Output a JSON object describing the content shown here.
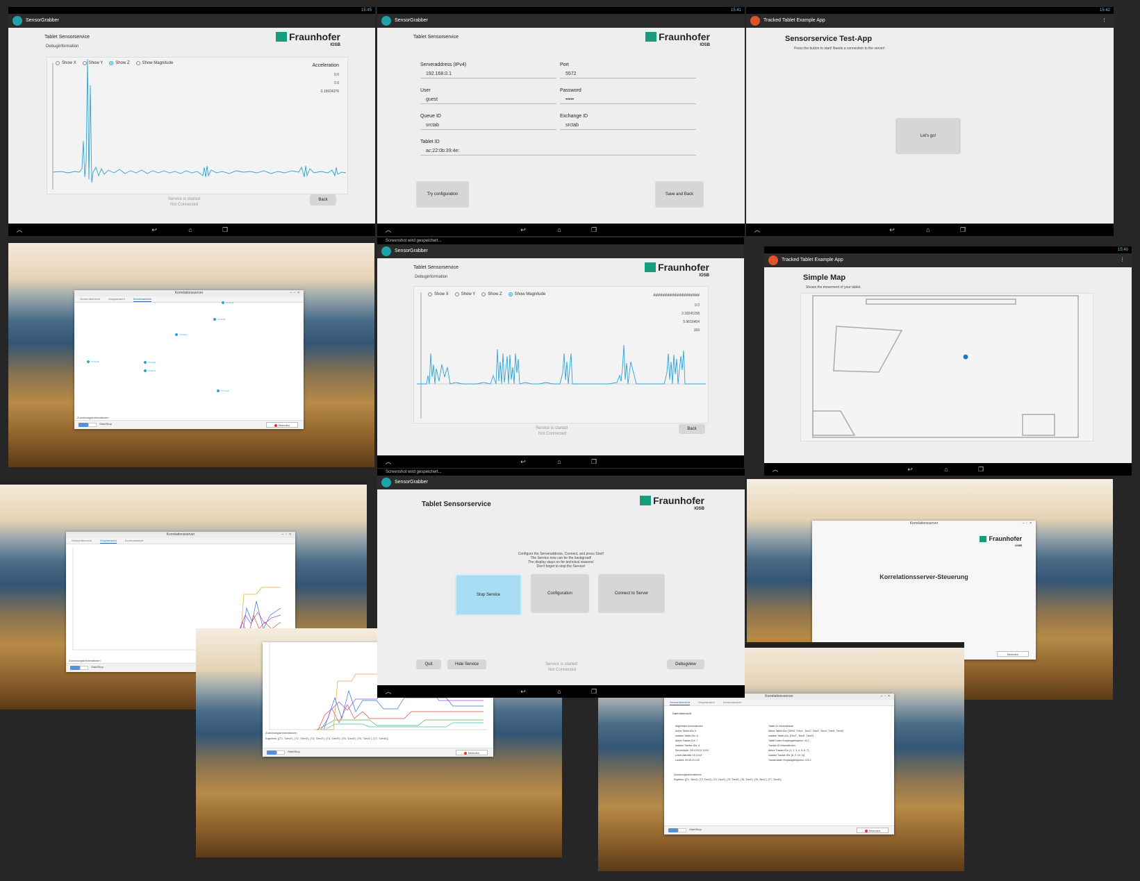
{
  "panel_debug_z": {
    "status_time": "15:45",
    "app_name": "SensorGrabber",
    "title": "Tablet Sensorservice",
    "subtitle": "Debuginformation",
    "logo_name": "Fraunhofer",
    "logo_sub": "IOSB",
    "radios": [
      {
        "label": "Show X",
        "selected": false
      },
      {
        "label": "Show Y",
        "selected": false
      },
      {
        "label": "Show Z",
        "selected": true
      },
      {
        "label": "Show Magnitude",
        "selected": false
      }
    ],
    "readout_title": "Acceleration",
    "readout_values": [
      "0.0",
      "0.0",
      "0.19924376"
    ],
    "status_line1": "Service is started",
    "status_line2": "Not Connected",
    "back_label": "Back"
  },
  "panel_config": {
    "status_time": "15:41",
    "app_name": "SensorGrabber",
    "title": "Tablet Sensorservice",
    "logo_name": "Fraunhofer",
    "logo_sub": "IOSB",
    "fields": {
      "server_label": "Serveraddress (IPv4)",
      "server_value": "192.168.0.1",
      "port_label": "Port",
      "port_value": "5572",
      "user_label": "User",
      "user_value": "guest",
      "password_label": "Password",
      "password_value": "•••••",
      "queue_label": "Queue ID",
      "queue_value": "srctab",
      "exchange_label": "Exchange ID",
      "exchange_value": "srctab",
      "tablet_label": "Tablet ID",
      "tablet_value": "ac:22:0b:39:4e:"
    },
    "try_label": "Try configuration",
    "save_label": "Save and Back"
  },
  "panel_testapp": {
    "status_time": "15:42",
    "app_name": "Tracked Tablet Example App",
    "title": "Sensorservice Test-App",
    "subtitle": "Press the button to start! Needs a connection to the server!",
    "go_label": "Let's go!"
  },
  "panel_desktop1": {
    "window_title": "Korrelationsserver",
    "tabs": [
      "Sensorübersicht",
      "Graphansicht",
      "Kameraansicht"
    ],
    "active_tab": 2,
    "point_labels": [
      "T1 Dev4",
      "T2 Dev3",
      "T3 Dev2",
      "T4 Dev5",
      "T5 Dev0",
      "T6 Dev1",
      "T7 Dev6"
    ],
    "footer_label": "Zuordnungsinformationen",
    "start_stop": "Start/Stop",
    "end_label": "Beenden"
  },
  "panel_debug_mag": {
    "status_bar_text": "Screenshot wird gespeichert...",
    "app_name": "SensorGrabber",
    "title": "Tablet Sensorservice",
    "subtitle": "Debuginformation",
    "logo_name": "Fraunhofer",
    "logo_sub": "IOSB",
    "radios": [
      {
        "label": "Show X",
        "selected": false
      },
      {
        "label": "Show Y",
        "selected": false
      },
      {
        "label": "Show Z",
        "selected": false
      },
      {
        "label": "Show Magnitude",
        "selected": true
      }
    ],
    "readout_title": "####################",
    "readout_values": [
      "0.0",
      "3.18241158",
      "5.9616404",
      "169"
    ],
    "status_line1": "Service is started",
    "status_line2": "Not Connected",
    "back_label": "Back"
  },
  "panel_map": {
    "status_time": "15:40",
    "app_name": "Tracked Tablet Example App",
    "title": "Simple Map",
    "subtitle": "Shows the movement of your tablet."
  },
  "panel_desktop2": {
    "window_title": "Korrelationsserver",
    "tabs": [
      "Sensorübersicht",
      "Graphansicht",
      "Kameraansicht"
    ],
    "active_tab": 1,
    "footer_label": "Zuordnungsinformationen",
    "start_stop": "Start/Stop",
    "end_label": "Beenden"
  },
  "panel_main": {
    "status_bar_text": "Screenshot wird gespeichert...",
    "app_name": "SensorGrabber",
    "title": "Tablet Sensorservice",
    "logo_name": "Fraunhofer",
    "logo_sub": "IOSB",
    "instructions": [
      "Configure the Serveraddress, Connect, and press Start!",
      "The Service now can be the backgroud!",
      "The display stays on for technical reasons!",
      "Don't forget to stop the Service!"
    ],
    "stop_label": "Stop Service",
    "config_label": "Configuration",
    "connect_label": "Connect to Server",
    "quit_label": "Quit",
    "hide_label": "Hide Service",
    "status_line1": "Service is started",
    "status_line2": "Not Connected",
    "debug_label": "Debugview"
  },
  "panel_desktop3": {
    "window_title": "Korrelationsserver",
    "logo_name": "Fraunhofer",
    "logo_sub": "IOSB",
    "heading": "Korrelationsserver-Steuerung",
    "end_label": "Beenden"
  },
  "panel_desktop4": {
    "footer_label": "Zuordnungsinformationen",
    "ergebnis_text": "Ergebnis: [(T1, 'Dev4'), (T2, 'Dev3'), (T3, 'Dev2'), (T4, 'Dev5'), (T5, 'Dev0'), (T6, 'Dev1'), (T7, 'Dev6')]",
    "start_stop": "Start/Stop",
    "end_label": "Beenden"
  },
  "panel_desktop5": {
    "window_title": "Korrelationsserver",
    "tabs": [
      "Sensorübersicht",
      "Graphansicht",
      "Kameraansicht"
    ],
    "active_tab": 0,
    "section_title": "Datenübersicht",
    "left_heading": "Allgemeine Informationen",
    "left_rows": [
      {
        "k": "Aktive Tablet-IDs:",
        "v": "6"
      },
      {
        "k": "Inaktive Tablet-IDs:",
        "v": "6"
      },
      {
        "k": "Aktive Tracker-IDs:",
        "v": "7"
      },
      {
        "k": "Inaktive Tracker-IDs:",
        "v": "4"
      },
      {
        "k": "Serverstarte:",
        "v": "2014.03.21 13:02"
      },
      {
        "k": "Letzte Aktivität:",
        "v": "13:13:42"
      },
      {
        "k": "Laufzeit:",
        "v": "00:00:23.125"
      }
    ],
    "right_heading": "Tablet-ID Informationen",
    "right_rows": [
      {
        "k": "Aktive Tablet-IDs:",
        "v": "['Dev0', 'Dev1', 'Dev2', 'Dev3', 'Dev4', 'Dev5', 'Dev6']"
      },
      {
        "k": "Inaktive Tablet-IDs:",
        "v": "['Dev7', 'Dev8', 'Dev9']"
      },
      {
        "k": "Tablet Daten Empfangsfrequenz:",
        "v": "43.2"
      }
    ],
    "right_heading2": "Tracker-ID Informationen",
    "right_rows2": [
      {
        "k": "Aktive Tracker-IDs:",
        "v": "[1, 2, 3, 4, 5, 6, 7]"
      },
      {
        "k": "Inaktive Tracker-IDs:",
        "v": "[8, 9, 10, 11]"
      },
      {
        "k": "Trackerdaten Empfangsfrequenz:",
        "v": "120.2"
      }
    ],
    "assign_heading": "Zuordnungsinformationen",
    "assign_text": "Ergebnis: [(T1, 'Dev4'), (T2, 'Dev3'), (T3, 'Dev2'), (T4, 'Dev5'), (T5, 'Dev0'), (T6, 'Dev1'), (T7, 'Dev6')]",
    "start_stop": "Start/Stop",
    "end_label": "Beenden"
  }
}
